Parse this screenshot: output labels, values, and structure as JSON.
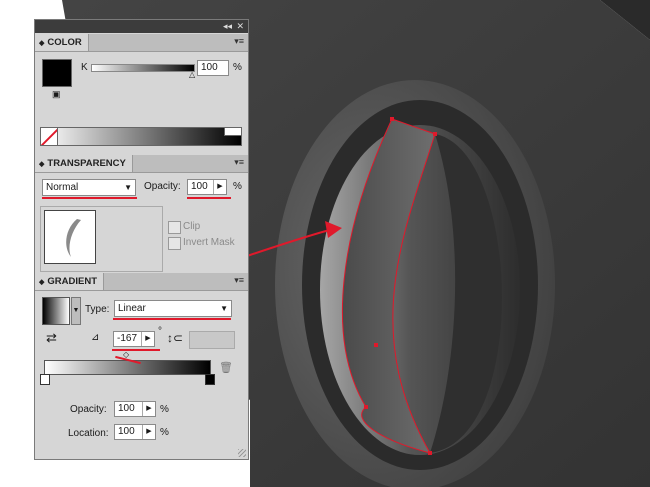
{
  "color_panel": {
    "tab_label": "COLOR",
    "channel_label": "K",
    "channel_value": "100",
    "percent": "%",
    "slider_level": 1.0
  },
  "transparency_panel": {
    "tab_label": "TRANSPARENCY",
    "blend_mode": "Normal",
    "opacity_label": "Opacity:",
    "opacity_value": "100",
    "percent": "%",
    "clip_label": "Clip",
    "invert_mask_label": "Invert Mask"
  },
  "gradient_panel": {
    "tab_label": "GRADIENT",
    "type_label": "Type:",
    "type_value": "Linear",
    "angle_value": "-167",
    "degree_symbol": "°",
    "opacity_label": "Opacity:",
    "opacity_value": "100",
    "location_label": "Location:",
    "location_value": "100",
    "percent": "%"
  },
  "colors": {
    "panel_bg": "#d6d6d6",
    "annotation_red": "#e0192b",
    "canvas_dark": "#3a3a3a"
  },
  "icons": [
    "panel-collapse-icon",
    "panel-close-icon",
    "panel-menu-icon",
    "swatch-icon",
    "none-swatch-icon",
    "angle-icon",
    "aspect-ratio-icon",
    "reverse-gradient-icon",
    "trash-icon"
  ]
}
